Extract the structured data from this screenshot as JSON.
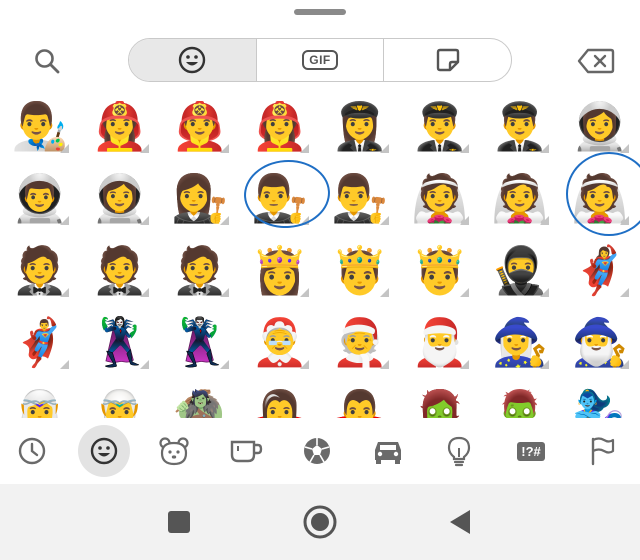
{
  "colors": {
    "icon_gray": "#6a6a6a",
    "active_bg": "#e8e8e8",
    "annotation_blue": "#1f6fc5",
    "nav_bg": "#f2f2f2"
  },
  "topbar": {
    "search_icon": "search-icon",
    "backspace_icon": "backspace-icon",
    "tabs": [
      {
        "name": "emoji",
        "icon": "smiley-icon",
        "active": true
      },
      {
        "name": "gif",
        "label": "GIF",
        "active": false
      },
      {
        "name": "sticker",
        "icon": "sticker-icon",
        "active": false
      }
    ]
  },
  "emoji_grid": {
    "rows": [
      [
        "👨‍🎨",
        "👩‍🚒",
        "👨‍🚒",
        "👩‍🚒",
        "👩‍✈️",
        "👨‍✈️",
        "👨‍✈️",
        "👩‍🚀"
      ],
      [
        "👨‍🚀",
        "👩‍🚀",
        "👩‍⚖️",
        "👨‍⚖️",
        "👨‍⚖️",
        "👰",
        "👰",
        "👰"
      ],
      [
        "🤵",
        "🤵",
        "🤵",
        "👸",
        "🤴",
        "🤴",
        "🥷",
        "🦸‍♀️"
      ],
      [
        "🦸‍♂️",
        "🦹‍♀️",
        "🦹‍♂️",
        "🤶",
        "🧑‍🎄",
        "🎅",
        "🧙‍♀️",
        "🧙‍♂️"
      ],
      [
        "🧝‍♀️",
        "🧝‍♂️",
        "🧌",
        "🧛‍♀️",
        "🧛‍♂️",
        "🧟‍♀️",
        "🧟‍♂️",
        "🧞‍♀️"
      ]
    ]
  },
  "categories": [
    {
      "name": "recent",
      "icon": "clock-icon",
      "active": false
    },
    {
      "name": "smileys",
      "icon": "smiley-icon",
      "active": true
    },
    {
      "name": "animals",
      "icon": "bear-icon",
      "active": false
    },
    {
      "name": "food",
      "icon": "cup-icon",
      "active": false
    },
    {
      "name": "activity",
      "icon": "soccer-ball-icon",
      "active": false
    },
    {
      "name": "travel",
      "icon": "car-icon",
      "active": false
    },
    {
      "name": "objects",
      "icon": "lightbulb-icon",
      "active": false
    },
    {
      "name": "symbols",
      "label": "!?#",
      "active": false
    },
    {
      "name": "flags",
      "icon": "flag-icon",
      "active": false
    }
  ],
  "navbar": {
    "recents_icon": "square-icon",
    "home_icon": "circle-icon",
    "back_icon": "back-triangle-icon"
  }
}
